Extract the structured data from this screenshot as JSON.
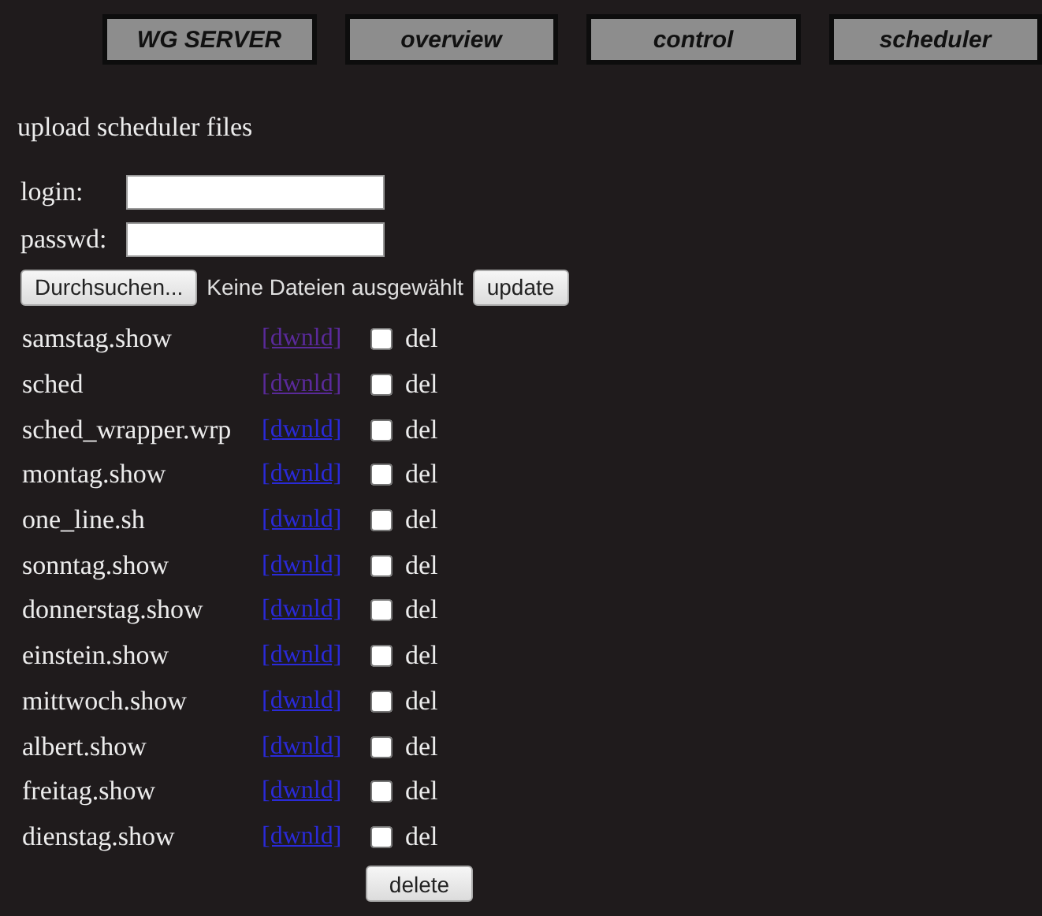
{
  "nav": [
    {
      "label": "WG SERVER"
    },
    {
      "label": "overview"
    },
    {
      "label": "control"
    },
    {
      "label": "scheduler"
    }
  ],
  "heading": "upload scheduler files",
  "login": {
    "label": "login:"
  },
  "passwd": {
    "label": "passwd:"
  },
  "upload": {
    "browse_button": "Durchsuchen...",
    "file_status": "Keine Dateien ausgewählt",
    "update_button": "update"
  },
  "files": [
    {
      "name": "samstag.show",
      "link": "[dwnld]",
      "visited": true,
      "checked": false,
      "del_label": "del"
    },
    {
      "name": "sched",
      "link": "[dwnld]",
      "visited": true,
      "checked": false,
      "del_label": "del"
    },
    {
      "name": "sched_wrapper.wrp",
      "link": "[dwnld]",
      "visited": false,
      "checked": false,
      "del_label": "del"
    },
    {
      "name": "montag.show",
      "link": "[dwnld]",
      "visited": false,
      "checked": false,
      "del_label": "del"
    },
    {
      "name": "one_line.sh",
      "link": "[dwnld]",
      "visited": false,
      "checked": false,
      "del_label": "del"
    },
    {
      "name": "sonntag.show",
      "link": "[dwnld]",
      "visited": false,
      "checked": false,
      "del_label": "del"
    },
    {
      "name": "donnerstag.show",
      "link": "[dwnld]",
      "visited": false,
      "checked": false,
      "del_label": "del"
    },
    {
      "name": "einstein.show",
      "link": "[dwnld]",
      "visited": false,
      "checked": false,
      "del_label": "del"
    },
    {
      "name": "mittwoch.show",
      "link": "[dwnld]",
      "visited": false,
      "checked": false,
      "del_label": "del"
    },
    {
      "name": "albert.show",
      "link": "[dwnld]",
      "visited": false,
      "checked": false,
      "del_label": "del"
    },
    {
      "name": "freitag.show",
      "link": "[dwnld]",
      "visited": false,
      "checked": false,
      "del_label": "del"
    },
    {
      "name": "dienstag.show",
      "link": "[dwnld]",
      "visited": false,
      "checked": false,
      "del_label": "del"
    }
  ],
  "delete_button": "delete"
}
